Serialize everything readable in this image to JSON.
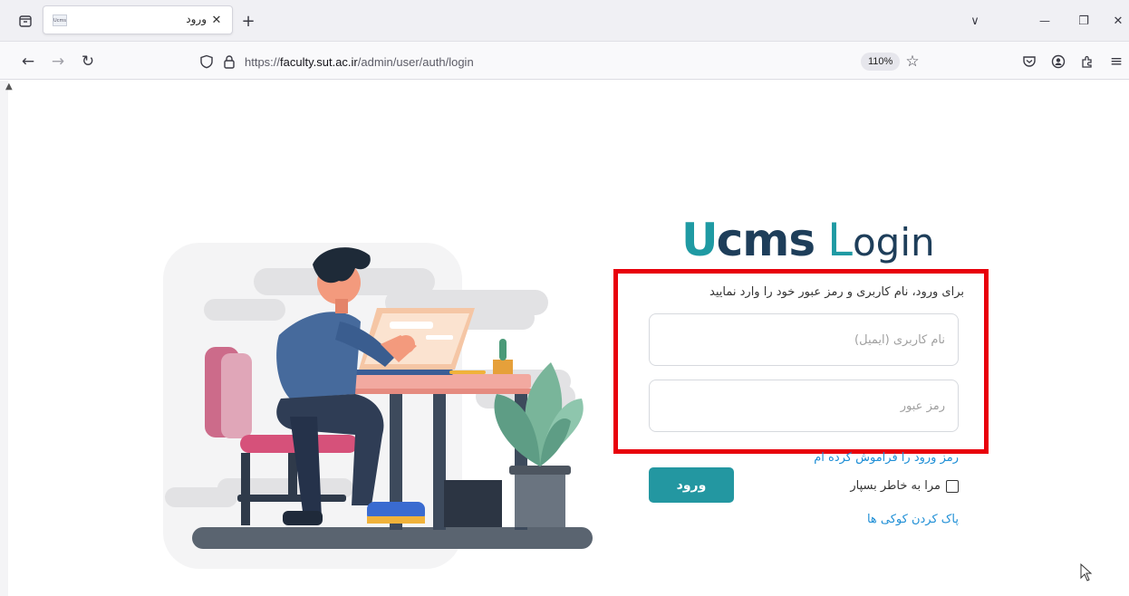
{
  "browser": {
    "tab": {
      "title": "ورود",
      "favicon_text": "Ucms",
      "close_label": "✕"
    },
    "new_tab_label": "+",
    "address": {
      "scheme": "https://",
      "host": "faculty.sut.ac.ir",
      "path": "/admin/user/auth/login"
    },
    "zoom": "110%",
    "window_controls": {
      "minimize": "—",
      "restore": "❐",
      "close": "✕"
    },
    "nav": {
      "back": "←",
      "forward": "→",
      "reload": "↻",
      "menu": "≡",
      "tab_list": "∨",
      "bookmark": "☆"
    }
  },
  "login": {
    "logo": {
      "u": "U",
      "cms": "cms",
      "l": "L",
      "ogin": "ogin"
    },
    "instructions": "برای ورود، نام کاربری و رمز عبور خود را وارد نمایید",
    "username_placeholder": "نام کاربری (ایمیل)",
    "password_placeholder": "رمز عبور",
    "forgot_password": "رمز ورود را فراموش کرده ام",
    "login_button": "ورود",
    "remember_me": "مرا به خاطر بسپار",
    "clear_cookies": "پاک کردن کوکی ها"
  },
  "colors": {
    "brand_teal": "#1f9aa3",
    "brand_navy": "#1e3e5a",
    "button": "#2397a1",
    "link": "#1f8fd6",
    "highlight_box": "#e8000b"
  }
}
